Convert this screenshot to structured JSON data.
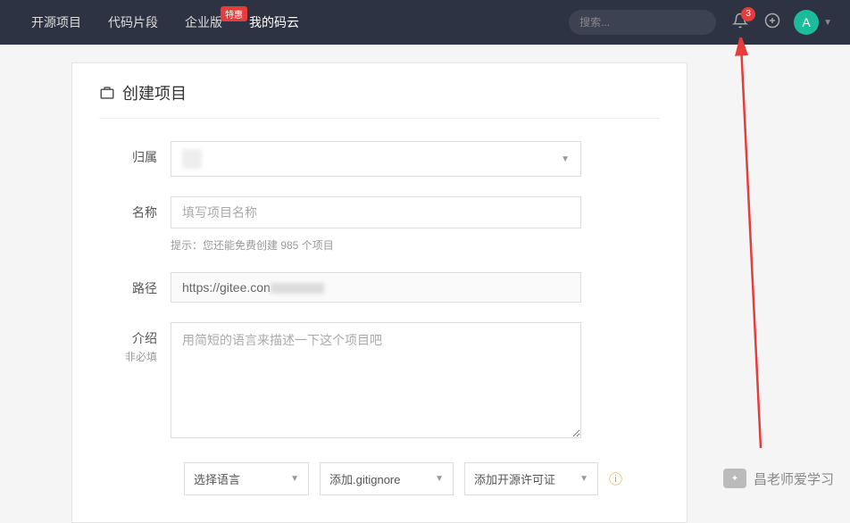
{
  "nav": {
    "items": [
      "开源项目",
      "代码片段",
      "企业版",
      "我的码云"
    ],
    "badge": "特惠"
  },
  "search": {
    "placeholder": "搜索..."
  },
  "notifications": {
    "count": "3"
  },
  "avatar": {
    "letter": "A"
  },
  "page": {
    "title": "创建项目"
  },
  "form": {
    "owner": {
      "label": "归属"
    },
    "name": {
      "label": "名称",
      "placeholder": "填写项目名称"
    },
    "hint": "提示：您还能免费创建 985 个项目",
    "path": {
      "label": "路径",
      "prefix": "https://gitee.con"
    },
    "intro": {
      "label": "介绍",
      "sub": "非必填",
      "placeholder": "用简短的语言来描述一下这个项目吧"
    },
    "selects": {
      "lang": "选择语言",
      "gitignore": "添加.gitignore",
      "license": "添加开源许可证"
    }
  },
  "watermark": "昌老师爱学习"
}
